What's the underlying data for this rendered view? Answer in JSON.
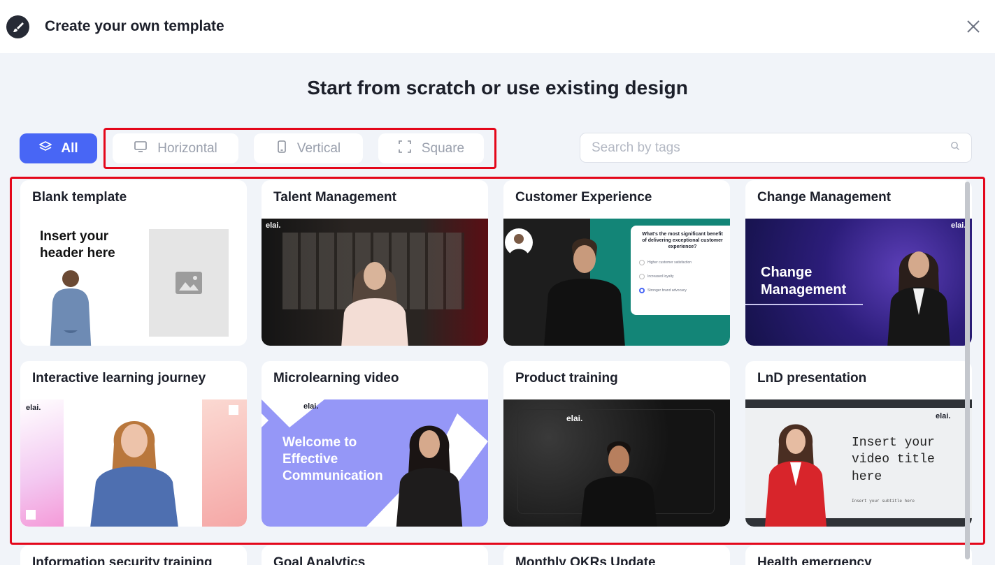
{
  "header": {
    "title": "Create your own template"
  },
  "headline": "Start from scratch or use existing design",
  "filters": {
    "all": "All",
    "horizontal": "Horizontal",
    "vertical": "Vertical",
    "square": "Square"
  },
  "search": {
    "placeholder": "Search by tags"
  },
  "cards": [
    {
      "title": "Blank template",
      "heading": "Insert your header here"
    },
    {
      "title": "Talent Management",
      "logo": "elai."
    },
    {
      "title": "Customer Experience",
      "question": "What's the most significant benefit of delivering exceptional customer experience?",
      "options": [
        "Higher customer satisfaction",
        "Increased loyalty",
        "Stronger brand advocacy"
      ]
    },
    {
      "title": "Change Management",
      "logo": "elai.",
      "heading": "Change Management"
    },
    {
      "title": "Interactive learning journey",
      "logo": "elai."
    },
    {
      "title": "Microlearning video",
      "logo": "elai.",
      "heading": "Welcome to Effective Communication"
    },
    {
      "title": "Product training",
      "logo": "elai."
    },
    {
      "title": "LnD presentation",
      "logo": "elai.",
      "heading": "Insert your video title here",
      "subtitle": "Insert your subtitle here"
    },
    {
      "title": "Information security training"
    },
    {
      "title": "Goal Analytics"
    },
    {
      "title": "Monthly OKRs Update"
    },
    {
      "title": "Health emergency"
    }
  ],
  "colors": {
    "accent": "#4866f5",
    "highlight": "#e4071b"
  }
}
